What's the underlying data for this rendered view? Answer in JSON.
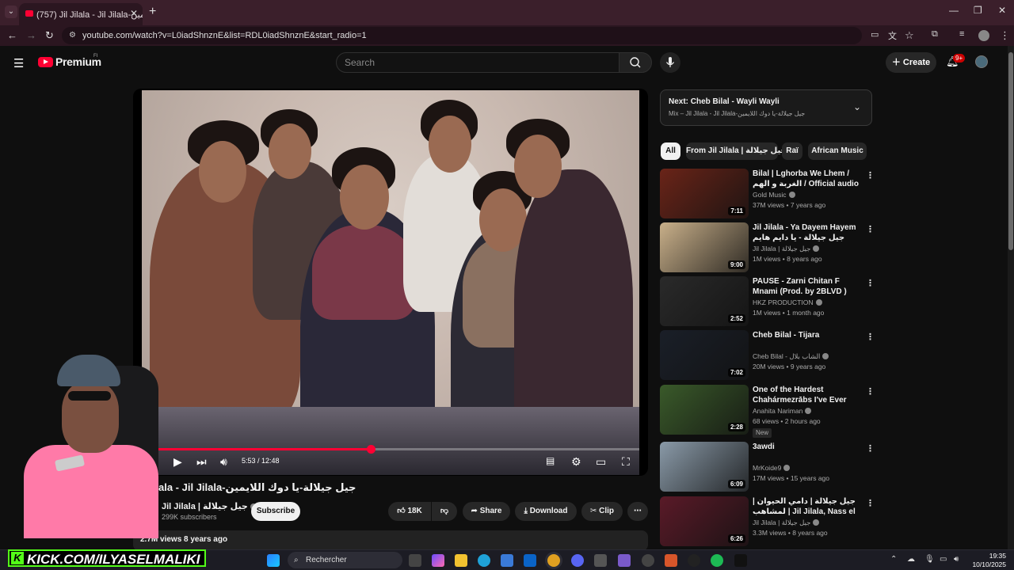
{
  "browser": {
    "tab_title": "(757) Jil Jilala - Jil Jilala-الايمين",
    "url": "youtube.com/watch?v=L0iadShnznE&list=RDL0iadShnznE&start_radio=1"
  },
  "header": {
    "logo_text": "Premium",
    "logo_sup": "FI",
    "search_placeholder": "Search",
    "create_label": "Create",
    "notifications_badge": "9+"
  },
  "player": {
    "time": "5:53 / 12:48",
    "progress_fraction": 0.46
  },
  "video": {
    "title": "ala - Jil Jilala-جيل جيلالة-يا دوك اللايمين",
    "channel": "Jil Jilala | جيل جيلالة",
    "subscribers": "299K subscribers",
    "subscribe_label": "Subscribe",
    "likes": "18K",
    "share_label": "Share",
    "download_label": "Download",
    "clip_label": "Clip",
    "views_line": "2.7M views  8 years ago"
  },
  "upnext": {
    "title": "Next: Cheb Bilal - Wayli Wayli",
    "subtitle": "Mix – Jil Jilala - Jil Jilala-جيل جيلالة-يا دوك اللايمين"
  },
  "chips": [
    "All",
    "From Jil Jilala | جيل جيلالة",
    "Raï",
    "African Music"
  ],
  "recommendations": [
    {
      "title": "Bilal | Lghorba We Lhem / الغربة و الهم / Official audio",
      "channel": "Gold Music",
      "meta": "37M views • 7 years ago",
      "duration": "7:11",
      "thumb_color": "#6a2418"
    },
    {
      "title": "Jil Jilala - Ya Dayem Hayem جيل جيلالة - يا دايم هايم",
      "channel": "Jil Jilala | جيل جيلالة",
      "meta": "1M views • 8 years ago",
      "duration": "9:00",
      "thumb_color": "#c9b08a"
    },
    {
      "title": "PAUSE - Zarni Chitan F Mnami (Prod. by 2BLVD )",
      "channel": "HKZ PRODUCTION",
      "meta": "1M views • 1 month ago",
      "duration": "2:52",
      "thumb_color": "#2a2a2a"
    },
    {
      "title": "Cheb Bilal - Tijara",
      "channel": "Cheb Bilal - الشاب بلال",
      "meta": "20M views • 9 years ago",
      "duration": "7:02",
      "thumb_color": "#1a1f28"
    },
    {
      "title": "One of the Hardest Chahármezrābs I've Ever Playe...",
      "channel": "Anahita Nariman",
      "meta": "68 views • 2 hours ago",
      "duration": "2:28",
      "badge": "New",
      "thumb_color": "#3a5a2a"
    },
    {
      "title": "3awdi",
      "channel": "MrKoide9",
      "meta": "17M views • 15 years ago",
      "duration": "6:09",
      "thumb_color": "#8a9aa8"
    },
    {
      "title": "جيل جيلالة | دامي الحيوان | لمشاهب | Jil Jilala, Nass el ... الزمن الجميل",
      "channel": "Jil Jilala | جيل جيلالة",
      "meta": "3.3M views • 8 years ago",
      "duration": "6:26",
      "thumb_color": "#5a1a28"
    }
  ],
  "overlay": {
    "kick_text": "KICK.COM/ILYASELMALIKI"
  },
  "taskbar": {
    "search_label": "Rechercher",
    "time": "19:35",
    "date": "10/10/2025"
  }
}
